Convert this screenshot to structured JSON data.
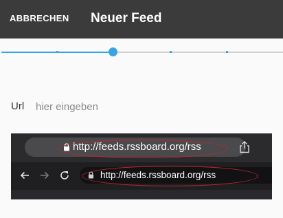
{
  "appbar": {
    "cancel_label": "ABBRECHEN",
    "title": "Neuer Feed",
    "background": "#3b3b3b"
  },
  "stepper": {
    "current_step": 3,
    "accent": "#37a4e6"
  },
  "form": {
    "url_label": "Url",
    "url_value": "",
    "url_placeholder": "hier eingeben"
  },
  "illustration": {
    "mobile_url": "http://feeds.rssboard.org/rss",
    "desktop_url": "http://feeds.rssboard.org/rss",
    "highlight_color": "#c0262b"
  }
}
